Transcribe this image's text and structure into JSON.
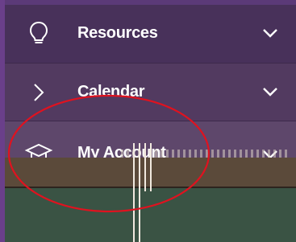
{
  "menu": {
    "items": [
      {
        "label": "Resources",
        "icon": "lightbulb-icon",
        "chevron": "chevron-down-icon"
      },
      {
        "label": "Calendar",
        "icon": "chevron-right-icon",
        "chevron": "chevron-down-icon"
      },
      {
        "label": "My Account",
        "icon": "graduation-cap-icon",
        "chevron": "chevron-down-icon"
      }
    ]
  },
  "colors": {
    "menu_bg": "#48315a",
    "text": "#ffffff",
    "annotation": "#e0121f"
  }
}
